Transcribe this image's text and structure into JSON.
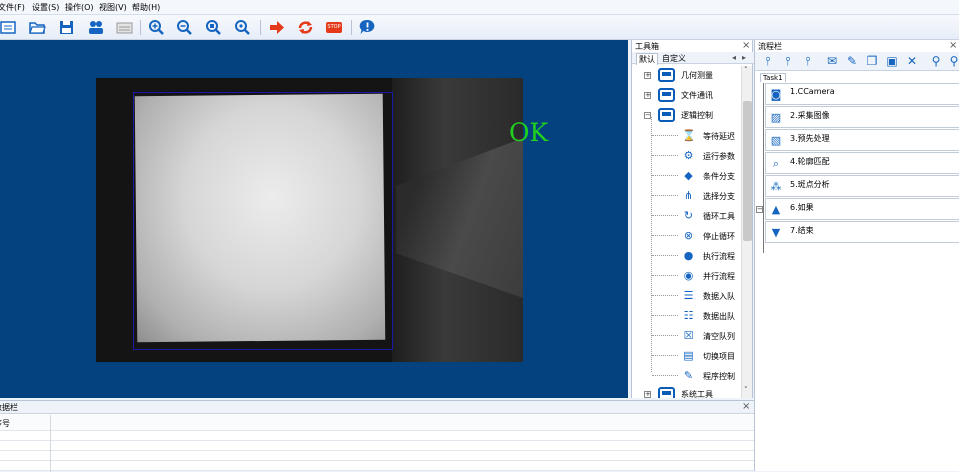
{
  "menu": [
    "文件(F)",
    "设置(S)",
    "操作(O)",
    "视图(V)",
    "帮助(H)"
  ],
  "toolbar": {
    "buttons": [
      "new-icon",
      "open-folder-icon",
      "save-icon",
      "users-icon",
      "keyboard-icon",
      "zoom-in-icon",
      "zoom-out-icon",
      "zoom-fit-icon",
      "zoom-actual-icon",
      "run-once-icon",
      "run-loop-icon",
      "stop-icon",
      "about-icon"
    ],
    "stop_label": "STOP"
  },
  "canvas": {
    "result_text": "OK"
  },
  "toolbox": {
    "title": "工具箱",
    "close": "×",
    "tabs": [
      "默认",
      "自定义"
    ],
    "tab_nav": [
      "◂",
      "▸"
    ],
    "categories": [
      "几何测量",
      "文件通讯",
      "逻辑控制",
      "系统工具"
    ],
    "tools": [
      {
        "label": "等待延迟",
        "icon": "hourglass-icon"
      },
      {
        "label": "运行参数",
        "icon": "gear-search-icon"
      },
      {
        "label": "条件分支",
        "icon": "condition-branch-icon"
      },
      {
        "label": "选择分支",
        "icon": "select-branch-icon"
      },
      {
        "label": "循环工具",
        "icon": "loop-icon"
      },
      {
        "label": "停止循环",
        "icon": "stop-loop-icon"
      },
      {
        "label": "执行流程",
        "icon": "execute-flow-icon"
      },
      {
        "label": "并行流程",
        "icon": "parallel-flow-icon"
      },
      {
        "label": "数据入队",
        "icon": "enqueue-icon"
      },
      {
        "label": "数据出队",
        "icon": "dequeue-icon"
      },
      {
        "label": "清空队列",
        "icon": "clear-queue-icon"
      },
      {
        "label": "切换项目",
        "icon": "switch-project-icon"
      },
      {
        "label": "程序控制",
        "icon": "program-control-icon"
      }
    ]
  },
  "flowbar": {
    "title": "流程栏",
    "close": "×",
    "task_tab": "Task1",
    "steps": [
      {
        "label": "1.CCamera",
        "icon": "camera-icon"
      },
      {
        "label": "2.采集图像",
        "icon": "capture-image-icon"
      },
      {
        "label": "3.预先处理",
        "icon": "preprocess-icon"
      },
      {
        "label": "4.轮廓匹配",
        "icon": "contour-match-icon"
      },
      {
        "label": "5.斑点分析",
        "icon": "blob-analysis-icon"
      },
      {
        "label": "6.如果",
        "icon": "if-icon"
      },
      {
        "label": "7.结束",
        "icon": "end-icon"
      }
    ]
  },
  "data_panel": {
    "title": "数据栏",
    "close": "×",
    "column_header": "序号"
  },
  "colors": {
    "canvas_bg": "#03417f",
    "ok_green": "#1fd21f",
    "accent_blue": "#1565c0"
  }
}
